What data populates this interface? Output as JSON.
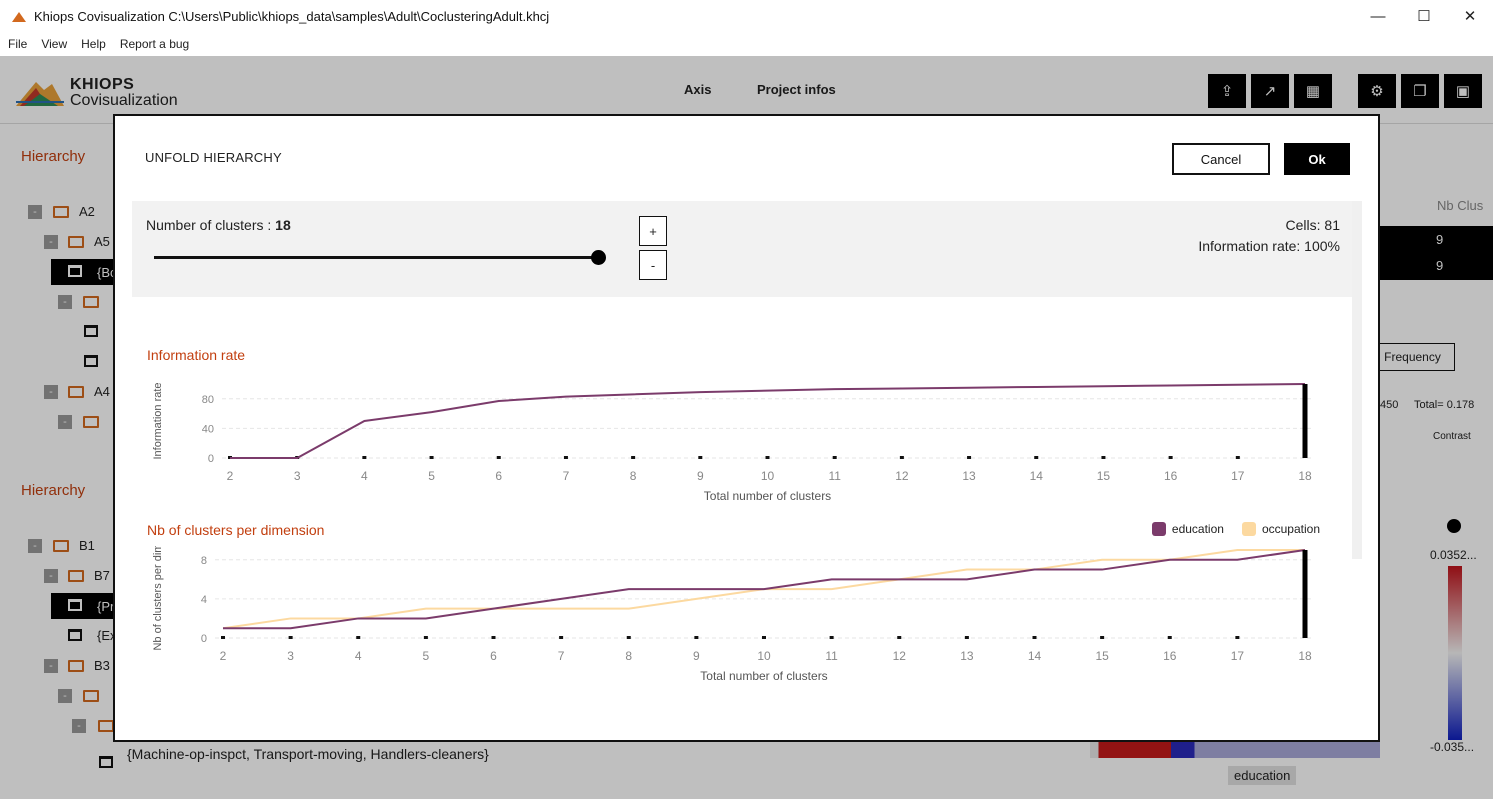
{
  "window": {
    "title": "Khiops Covisualization C:\\Users\\Public\\khiops_data\\samples\\Adult\\CoclusteringAdult.khcj",
    "minimize": "—",
    "maximize": "☐",
    "close": "✕"
  },
  "menu": [
    "File",
    "View",
    "Help",
    "Report a bug"
  ],
  "header": {
    "logo_line1": "KHIOPS",
    "logo_line2": "Covisualization",
    "tabs": [
      "Axis",
      "Project infos"
    ]
  },
  "background": {
    "hierarchy_label": "Hierarchy",
    "tree_a": [
      "A2",
      "A5",
      "{Bc",
      "A4"
    ],
    "tree_b": [
      "B1",
      "B7",
      "{Pr",
      "{Ex",
      "B3"
    ],
    "leaf_text": "{Machine-op-inspct, Transport-moving, Handlers-cleaners}",
    "nb_clus": "Nb Clus",
    "nb_values": [
      "9",
      "9"
    ],
    "frequency": "Frequency",
    "total_left": "450",
    "total": "Total= 0.178",
    "contrast": "Contrast",
    "scale_top": "0.0352...",
    "scale_bottom": "-0.035...",
    "x_dim": "education"
  },
  "modal": {
    "title": "UNFOLD HIERARCHY",
    "cancel": "Cancel",
    "ok": "Ok",
    "clusters_label": "Number of clusters : ",
    "clusters_value": "18",
    "plus": "+",
    "minus": "-",
    "cells": "Cells: 81",
    "information_rate": "Information rate: 100%",
    "slider_fraction": 1.0
  },
  "chart_data": [
    {
      "type": "line",
      "title": "Information rate",
      "xlabel": "Total number of clusters",
      "ylabel": "Information rate",
      "x": [
        2,
        3,
        4,
        5,
        6,
        7,
        8,
        9,
        10,
        11,
        12,
        13,
        14,
        15,
        16,
        17,
        18
      ],
      "series": [
        {
          "name": "",
          "color": "#7b3b6b",
          "values": [
            0,
            0,
            50,
            62,
            77,
            83,
            86,
            89,
            91,
            93,
            94,
            95,
            96,
            97,
            98,
            99,
            100
          ]
        }
      ],
      "yticks": [
        0,
        40,
        80
      ],
      "ylim": [
        0,
        100
      ],
      "grid": true,
      "selected_x": 18
    },
    {
      "type": "line",
      "title": "Nb of clusters per dimension",
      "xlabel": "Total number of clusters",
      "ylabel": "Nb of clusters per dime",
      "x": [
        2,
        3,
        4,
        5,
        6,
        7,
        8,
        9,
        10,
        11,
        12,
        13,
        14,
        15,
        16,
        17,
        18
      ],
      "series": [
        {
          "name": "education",
          "color": "#7b3b6b",
          "values": [
            1,
            1,
            2,
            2,
            3,
            4,
            5,
            5,
            5,
            6,
            6,
            6,
            7,
            7,
            8,
            8,
            9
          ]
        },
        {
          "name": "occupation",
          "color": "#fcd9a0",
          "values": [
            1,
            2,
            2,
            3,
            3,
            3,
            3,
            4,
            5,
            5,
            6,
            7,
            7,
            8,
            8,
            9,
            9
          ]
        }
      ],
      "yticks": [
        0,
        4,
        8
      ],
      "ylim": [
        0,
        9
      ],
      "grid": true,
      "legend_position": "top-right",
      "selected_x": 18
    }
  ]
}
